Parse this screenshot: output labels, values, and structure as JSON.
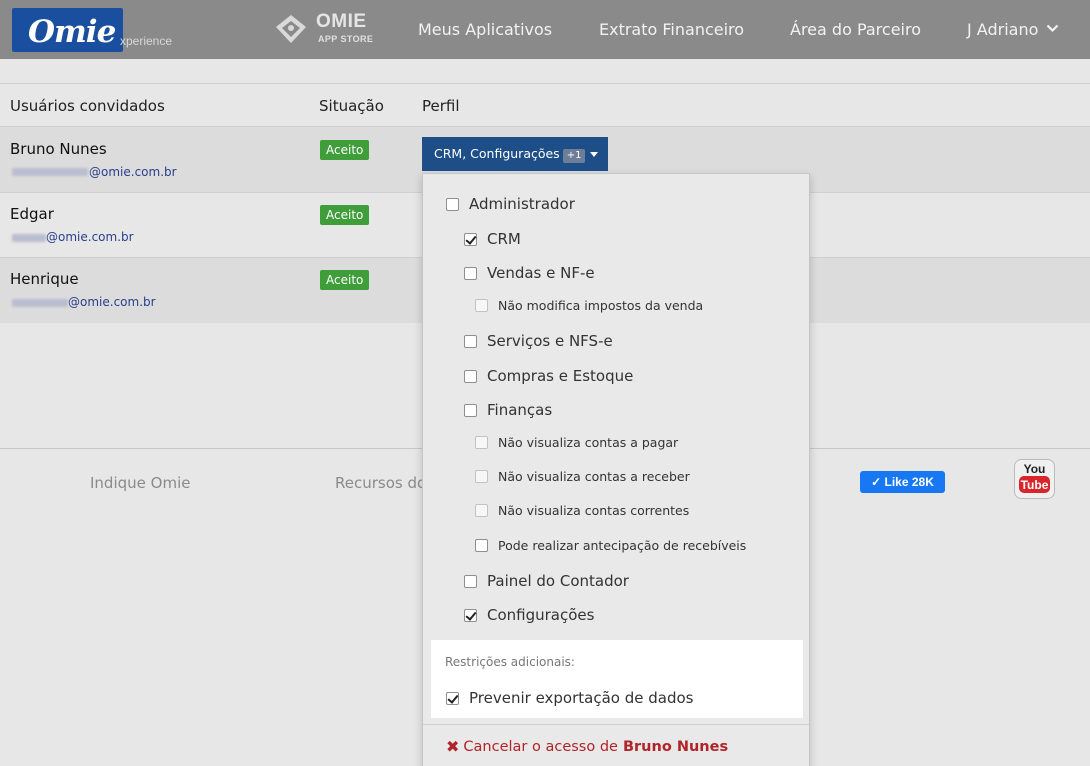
{
  "header": {
    "logo_text": "Omie",
    "logo_sub": "xperience",
    "store_name": "OMIE",
    "store_sub": "APP STORE",
    "nav": [
      "Meus Aplicativos",
      "Extrato Financeiro",
      "Área do Parceiro"
    ],
    "user": "J Adriano"
  },
  "table": {
    "headers": [
      "Usuários convidados",
      "Situação",
      "Perfil"
    ],
    "rows": [
      {
        "name": "Bruno Nunes",
        "email_domain": "@omie.com.br",
        "status": "Aceito"
      },
      {
        "name": "Edgar",
        "email_domain": "@omie.com.br",
        "status": "Aceito"
      },
      {
        "name": "Henrique",
        "email_domain": "@omie.com.br",
        "status": "Aceito"
      }
    ],
    "profile_button": {
      "label": "CRM, Configurações",
      "count": "+1"
    }
  },
  "dropdown": {
    "options": [
      {
        "label": "Administrador",
        "checked": false
      },
      {
        "label": "CRM",
        "checked": true
      },
      {
        "label": "Vendas e NF-e",
        "checked": false
      },
      {
        "label": "Não modifica impostos da venda",
        "checked": false
      },
      {
        "label": "Serviços e NFS-e",
        "checked": false
      },
      {
        "label": "Compras e Estoque",
        "checked": false
      },
      {
        "label": "Finanças",
        "checked": false
      },
      {
        "label": "Não visualiza contas a pagar",
        "checked": false
      },
      {
        "label": "Não visualiza contas a receber",
        "checked": false
      },
      {
        "label": "Não visualiza contas correntes",
        "checked": false
      },
      {
        "label": "Pode realizar antecipação de recebíveis",
        "checked": false
      },
      {
        "label": "Painel do Contador",
        "checked": false
      },
      {
        "label": "Configurações",
        "checked": true
      }
    ],
    "extra_title": "Restrições adicionais:",
    "extra_option": {
      "label": "Prevenir exportação de dados",
      "checked": true
    },
    "cancel_prefix": "Cancelar o acesso de",
    "cancel_name": "Bruno Nunes"
  },
  "footer": {
    "links": [
      "Indique Omie",
      "Recursos do"
    ],
    "like_label": "Like 28K",
    "youtube_top": "You",
    "youtube_bottom": "Tube"
  },
  "icons": {
    "store": "store-icon",
    "chevron": "chevron-down-icon",
    "check": "check-icon",
    "cancel": "x-icon",
    "youtube": "youtube-icon"
  },
  "colors": {
    "header_bg": "#8a8a8a",
    "logo_bg": "#1a4fa0",
    "primary": "#1d4e88",
    "accepted": "#3f9e3a",
    "cancel": "#b0242a",
    "facebook": "#1877f2"
  }
}
